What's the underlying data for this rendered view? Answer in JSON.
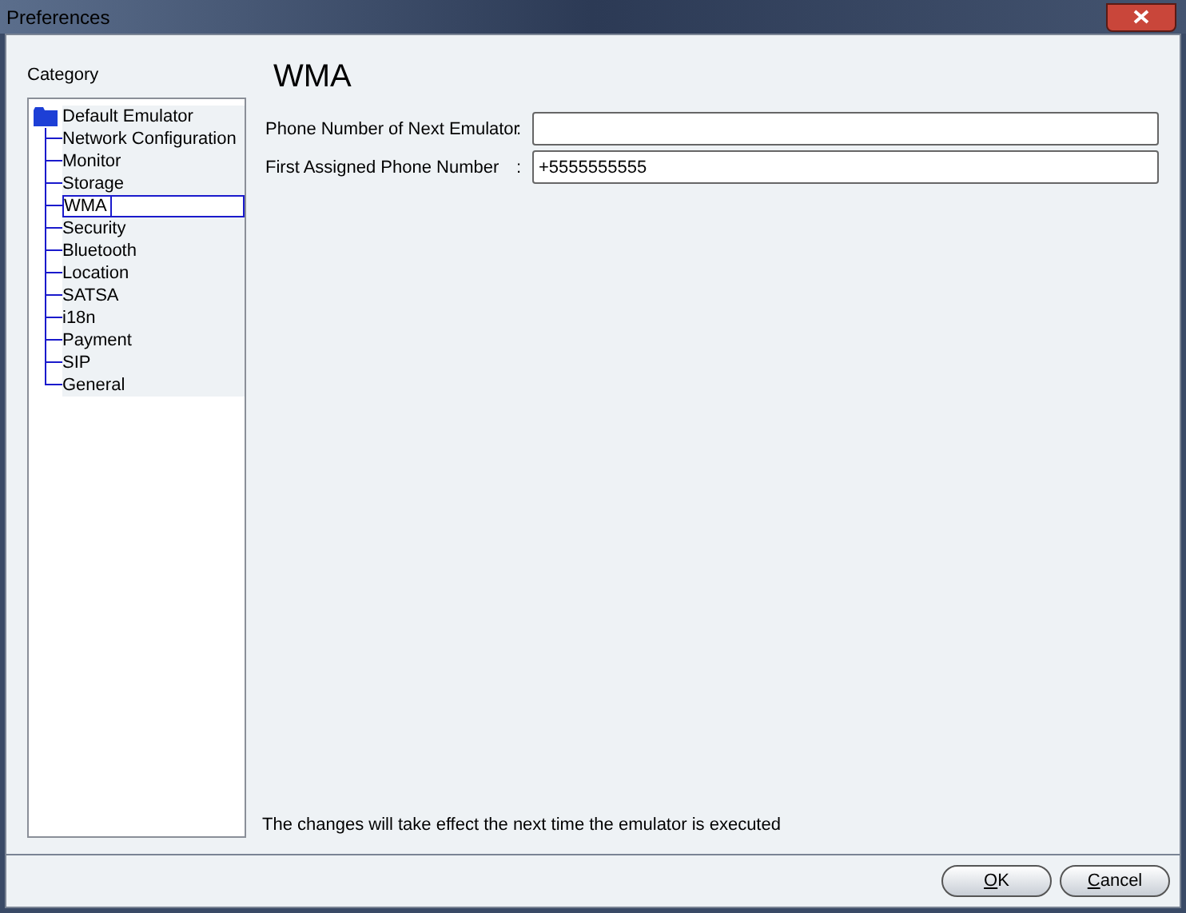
{
  "window": {
    "title": "Preferences"
  },
  "sidebar": {
    "heading": "Category",
    "root": {
      "label": "Default Emulator",
      "children": [
        {
          "label": "Network Configuration",
          "selected": false
        },
        {
          "label": "Monitor",
          "selected": false
        },
        {
          "label": "Storage",
          "selected": false
        },
        {
          "label": "WMA",
          "selected": true
        },
        {
          "label": "Security",
          "selected": false
        },
        {
          "label": "Bluetooth",
          "selected": false
        },
        {
          "label": "Location",
          "selected": false
        },
        {
          "label": "SATSA",
          "selected": false
        },
        {
          "label": "i18n",
          "selected": false
        },
        {
          "label": "Payment",
          "selected": false
        },
        {
          "label": "SIP",
          "selected": false
        },
        {
          "label": "General",
          "selected": false
        }
      ]
    }
  },
  "panel": {
    "title": "WMA",
    "fields": [
      {
        "label": "Phone Number of Next Emulator",
        "separator": ":"
      },
      {
        "label": "First Assigned Phone Number",
        "separator": ":",
        "value": "+5555555555"
      }
    ],
    "note": "The changes will take effect the next time the emulator is executed"
  },
  "buttons": [
    {
      "underlined": "O",
      "rest": "K"
    },
    {
      "underlined": "C",
      "rest": "ancel"
    }
  ]
}
